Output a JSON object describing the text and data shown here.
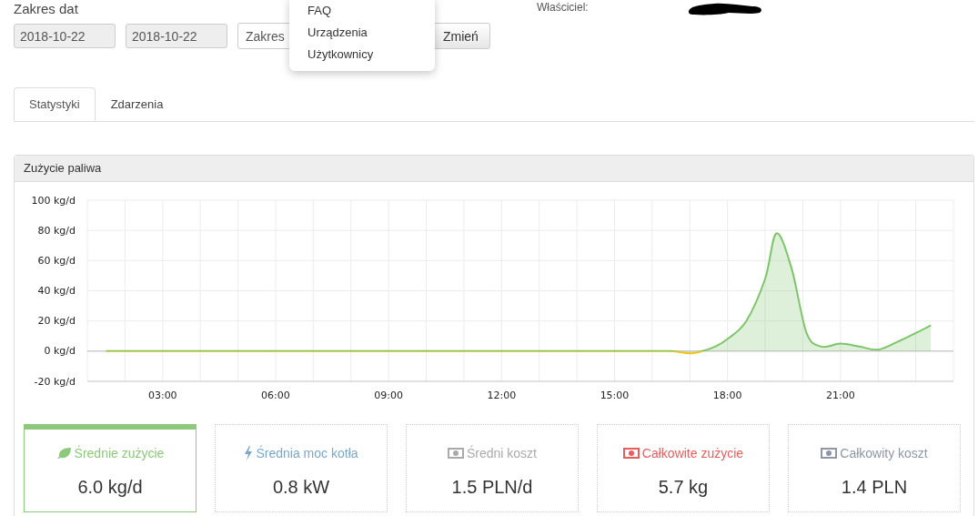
{
  "filters": {
    "label": "Zakres dat",
    "date_from": "2018-10-22",
    "date_to": "2018-10-22",
    "range_select": "Zakres",
    "apply_button": "Zmień"
  },
  "owner": {
    "label": "Właściciel:"
  },
  "dropdown_menu": [
    {
      "label": "FAQ"
    },
    {
      "label": "Urządzenia"
    },
    {
      "label": "Użytkownicy"
    }
  ],
  "tabs": [
    {
      "label": "Statystyki",
      "selected": true
    },
    {
      "label": "Zdarzenia",
      "selected": false
    }
  ],
  "panel": {
    "title": "Zużycie paliwa",
    "chart_data": {
      "type": "area",
      "x": [
        1.5,
        4,
        8,
        12,
        16,
        16.5,
        17,
        17.33,
        17.67,
        18,
        18.5,
        19,
        19.3,
        19.7,
        20.1,
        20.5,
        21,
        21.5,
        22,
        22.5,
        23,
        23.4
      ],
      "grid": true,
      "series": [
        {
          "color": "#7dc56a",
          "values": [
            0,
            0,
            0,
            0,
            0,
            0,
            -1.5,
            0,
            3,
            8,
            20,
            48,
            78,
            55,
            12,
            3,
            5,
            3,
            1,
            6,
            12,
            17
          ]
        }
      ],
      "xlim": [
        1,
        24
      ],
      "ylim": [
        -20,
        100
      ],
      "xticks": [
        {
          "value": 3,
          "label": "03:00"
        },
        {
          "value": 6,
          "label": "06:00"
        },
        {
          "value": 9,
          "label": "09:00"
        },
        {
          "value": 12,
          "label": "12:00"
        },
        {
          "value": 15,
          "label": "15:00"
        },
        {
          "value": 18,
          "label": "18:00"
        },
        {
          "value": 21,
          "label": "21:00"
        }
      ],
      "yticks": [
        {
          "value": 100,
          "label": "100 kg/d"
        },
        {
          "value": 80,
          "label": "80 kg/d"
        },
        {
          "value": 60,
          "label": "60 kg/d"
        },
        {
          "value": 40,
          "label": "40 kg/d"
        },
        {
          "value": 20,
          "label": "20 kg/d"
        },
        {
          "value": 0,
          "label": "0 kg/d"
        },
        {
          "value": -20,
          "label": "-20 kg/d"
        }
      ]
    }
  },
  "stats": [
    {
      "kind": "leaf",
      "label": "Średnie zużycie",
      "value": "6.0 kg/d",
      "color": "#8cc97a",
      "selected": true
    },
    {
      "kind": "bolt",
      "label": "Średnia moc kotła",
      "value": "0.8 kW",
      "color": "#7aa7cc",
      "selected": false
    },
    {
      "kind": "money",
      "label": "Średni koszt",
      "value": "1.5 PLN/d",
      "color": "#aaaaaa",
      "selected": false
    },
    {
      "kind": "money",
      "label": "Całkowite zużycie",
      "value": "5.7 kg",
      "color": "#e85c5c",
      "selected": false
    },
    {
      "kind": "money",
      "label": "Całkowity koszt",
      "value": "1.4 PLN",
      "color": "#8d97a7",
      "selected": false
    }
  ]
}
